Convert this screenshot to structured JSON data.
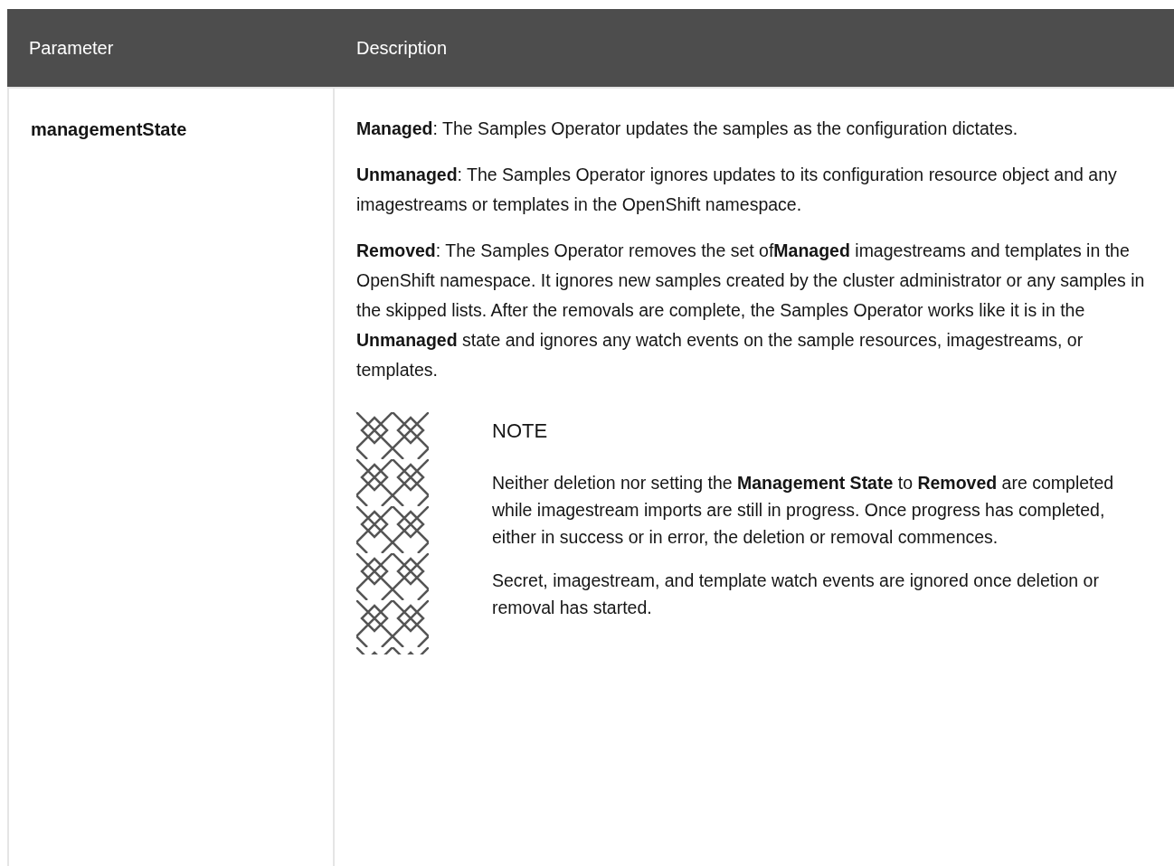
{
  "table": {
    "columns": [
      "Parameter",
      "Description"
    ],
    "rows": [
      {
        "parameter": "managementState",
        "paragraphs": [
          "**Managed**: The Samples Operator updates the samples as the configuration dictates.",
          "**Unmanaged**: The Samples Operator ignores updates to its configuration resource object and any imagestreams or templates in the OpenShift namespace.",
          "**Removed**: The Samples Operator removes the set of**Managed** imagestreams and templates in the OpenShift namespace. It ignores new samples created by the cluster administrator or any samples in the skipped lists. After the removals are complete, the Samples Operator works like it is in the **Unmanaged** state and ignores any watch events on the sample resources, imagestreams, or templates."
        ],
        "note": {
          "title": "NOTE",
          "paragraphs": [
            "Neither deletion nor setting the **Management State** to **Removed** are completed while imagestream imports are still in progress. Once progress has completed, either in success or in error, the deletion or removal commences.",
            "Secret, imagestream, and template watch events are ignored once deletion or removal has started."
          ]
        }
      }
    ]
  }
}
